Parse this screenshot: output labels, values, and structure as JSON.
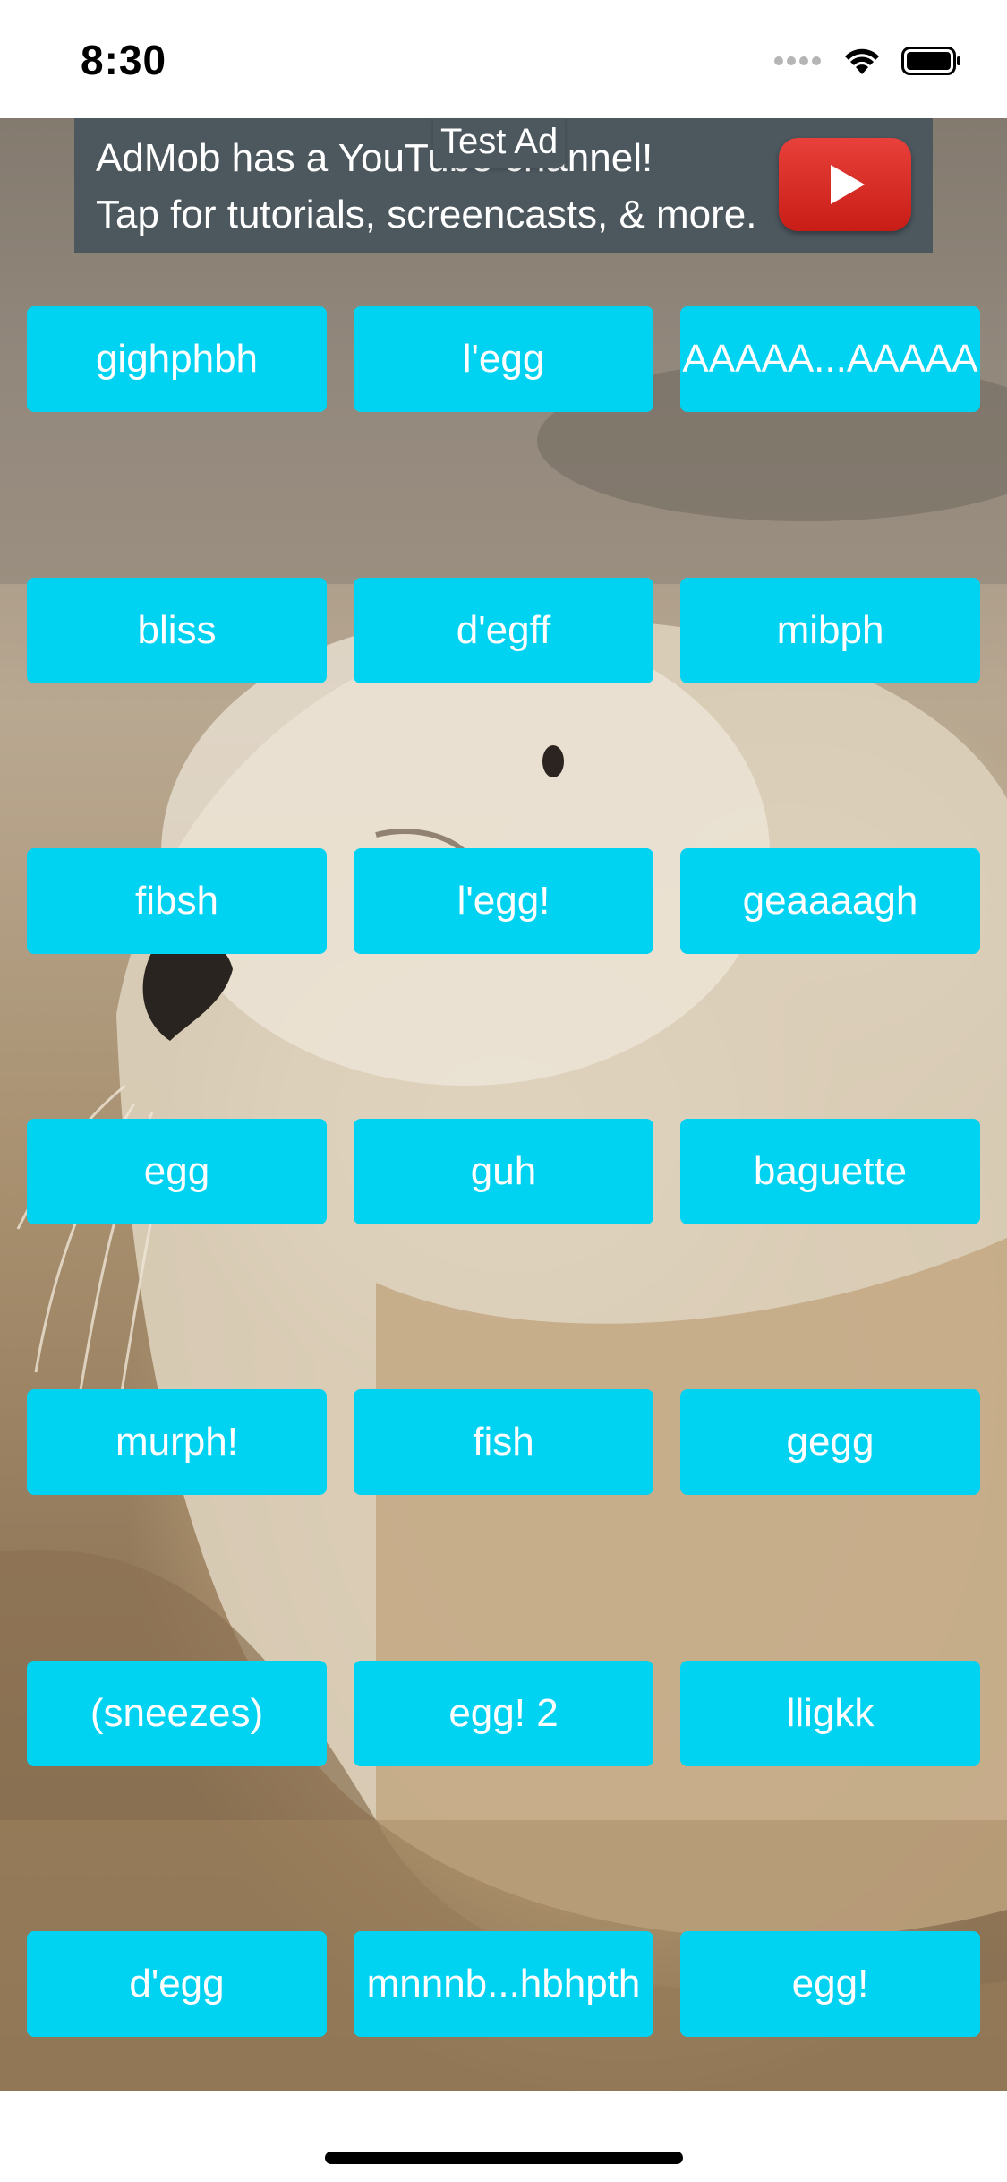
{
  "status_bar": {
    "time": "8:30",
    "icons": [
      "signal-dots-icon",
      "wifi-icon",
      "battery-icon"
    ]
  },
  "ad": {
    "line1": "AdMob has a YouTube channel! ",
    "line2": "Tap for tutorials, screencasts, & more.",
    "tag": "Test Ad",
    "icon": "youtube-play-icon"
  },
  "buttons": [
    [
      "gighphbh",
      "l'egg",
      "AAAAA...AAAAA"
    ],
    [
      "bliss",
      "d'egff",
      "mibph"
    ],
    [
      "fibsh",
      "l'egg!",
      "geaaaagh"
    ],
    [
      "egg",
      "guh",
      "baguette"
    ],
    [
      "murph!",
      "fish",
      "gegg"
    ],
    [
      "(sneezes)",
      "egg! 2",
      "lligkk"
    ],
    [
      "d'egg",
      "mnnnb...hbhpth",
      "egg!"
    ]
  ],
  "colors": {
    "button_bg": "#00d2f2",
    "button_text": "#ffffff",
    "ad_bg": "#4c575e",
    "play_red": "#d9261f"
  }
}
